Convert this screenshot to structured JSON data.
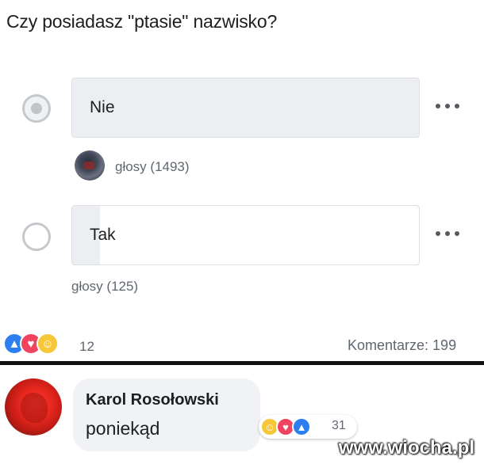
{
  "poll": {
    "question": "Czy posiadasz \"ptasie\" nazwisko?",
    "options": [
      {
        "label": "Nie",
        "votes_text": "głosy (1493)",
        "selected": true,
        "vote_share": 0.923
      },
      {
        "label": "Tak",
        "votes_text": "głosy (125)",
        "selected": false,
        "vote_share": 0.077
      }
    ]
  },
  "post_footer": {
    "reaction_icons": [
      "like-icon",
      "love-icon",
      "haha-icon"
    ],
    "reaction_count": "12",
    "comments_label": "Komentarze: 199"
  },
  "comment": {
    "author": "Karol Rosołowski",
    "text": "poniekąd",
    "reaction_icons": [
      "haha-icon",
      "love-icon",
      "like-icon"
    ],
    "reaction_count": "31"
  },
  "watermark": "www.wiocha.pl",
  "colors": {
    "like": "#2d7ff0",
    "love": "#f0435f",
    "haha": "#f7c73a",
    "option_fill": "#eceef1"
  }
}
